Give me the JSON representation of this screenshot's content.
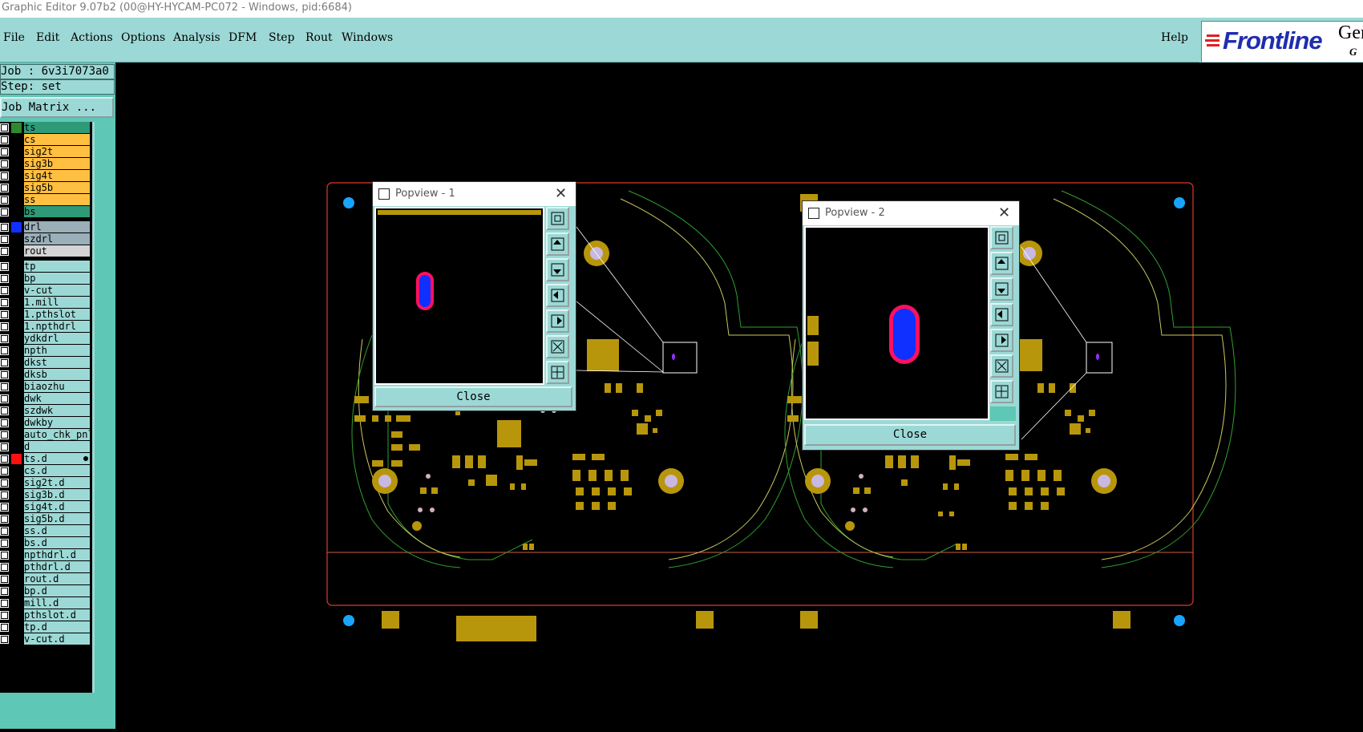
{
  "window": {
    "title": "Graphic Editor 9.07b2 (00@HY-HYCAM-PC072 - Windows, pid:6684)"
  },
  "menu": {
    "items": [
      "File",
      "Edit",
      "Actions",
      "Options",
      "Analysis",
      "DFM",
      "Step",
      "Rout",
      "Windows"
    ],
    "help": "Help"
  },
  "logo": {
    "brand": "Frontline",
    "product_fragment": "Ger",
    "sub_fragment": "G"
  },
  "job": {
    "job_text": "Job : 6v3i7073a0",
    "step_text": "Step: set",
    "matrix_button": "Job Matrix ..."
  },
  "layers": [
    {
      "name": "ts",
      "color": "#2e9a78",
      "swatch": "#2e8a2e"
    },
    {
      "name": "cs",
      "color": "#ffbf40"
    },
    {
      "name": "sig2t",
      "color": "#ffbf40"
    },
    {
      "name": "sig3b",
      "color": "#ffbf40"
    },
    {
      "name": "sig4t",
      "color": "#ffbf40"
    },
    {
      "name": "sig5b",
      "color": "#ffbf40"
    },
    {
      "name": "ss",
      "color": "#ffbf40"
    },
    {
      "name": "bs",
      "color": "#2e9a78"
    },
    {
      "name": "drl",
      "color": "#9aafb8",
      "swatch": "#1030ff"
    },
    {
      "name": "szdrl",
      "color": "#9aafb8"
    },
    {
      "name": "rout",
      "color": "#d4d4d4"
    },
    {
      "name": "tp",
      "color": "#9cd9d6"
    },
    {
      "name": "bp",
      "color": "#9cd9d6"
    },
    {
      "name": "v-cut",
      "color": "#9cd9d6"
    },
    {
      "name": "1.mill",
      "color": "#9cd9d6"
    },
    {
      "name": "1.pthslot",
      "color": "#9cd9d6"
    },
    {
      "name": "1.npthdrl",
      "color": "#9cd9d6"
    },
    {
      "name": "ydkdrl",
      "color": "#9cd9d6"
    },
    {
      "name": "npth",
      "color": "#9cd9d6"
    },
    {
      "name": "dkst",
      "color": "#9cd9d6"
    },
    {
      "name": "dksb",
      "color": "#9cd9d6"
    },
    {
      "name": "biaozhu",
      "color": "#9cd9d6"
    },
    {
      "name": "dwk",
      "color": "#9cd9d6"
    },
    {
      "name": "szdwk",
      "color": "#9cd9d6"
    },
    {
      "name": "dwkby",
      "color": "#9cd9d6"
    },
    {
      "name": "auto_chk_pnl",
      "color": "#9cd9d6"
    },
    {
      "name": "d",
      "color": "#9cd9d6"
    },
    {
      "name": "ts.d",
      "color": "#9cd9d6",
      "swatch": "#ff1010",
      "marker": true
    },
    {
      "name": "cs.d",
      "color": "#9cd9d6"
    },
    {
      "name": "sig2t.d",
      "color": "#9cd9d6"
    },
    {
      "name": "sig3b.d",
      "color": "#9cd9d6"
    },
    {
      "name": "sig4t.d",
      "color": "#9cd9d6"
    },
    {
      "name": "sig5b.d",
      "color": "#9cd9d6"
    },
    {
      "name": "ss.d",
      "color": "#9cd9d6"
    },
    {
      "name": "bs.d",
      "color": "#9cd9d6"
    },
    {
      "name": "npthdrl.d",
      "color": "#9cd9d6"
    },
    {
      "name": "pthdrl.d",
      "color": "#9cd9d6"
    },
    {
      "name": "rout.d",
      "color": "#9cd9d6"
    },
    {
      "name": "bp.d",
      "color": "#9cd9d6"
    },
    {
      "name": "mill.d",
      "color": "#9cd9d6"
    },
    {
      "name": "pthslot.d",
      "color": "#9cd9d6"
    },
    {
      "name": "tp.d",
      "color": "#9cd9d6"
    },
    {
      "name": "v-cut.d",
      "color": "#9cd9d6"
    }
  ],
  "popview1": {
    "title": "Popview - 1",
    "close_label": "Close"
  },
  "popview2": {
    "title": "Popview - 2",
    "close_label": "Close"
  },
  "colors": {
    "pad": "#b8960c",
    "outline": "#c8c860",
    "board_edge": "#ff3030",
    "drill": "#1030ff",
    "ring": "#ff1060",
    "fiducial": "#19a5ff"
  }
}
